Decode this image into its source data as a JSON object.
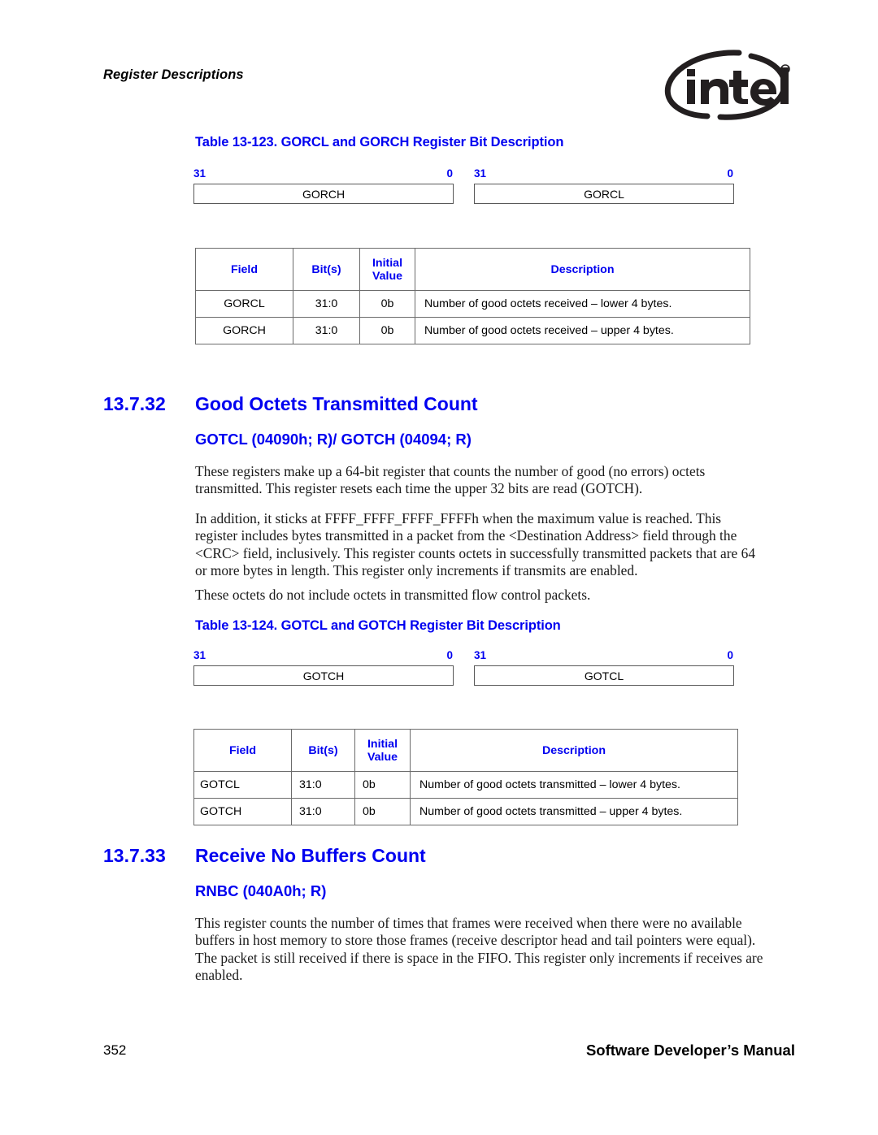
{
  "header": {
    "running_title": "Register Descriptions",
    "logo_wordmark": "intel",
    "logo_registered": "®"
  },
  "colors": {
    "heading_blue": "#0000f0",
    "table_border": "#6b6b6b",
    "register_box_border": "#595959",
    "body_text": "#1a1a1a"
  },
  "table_123": {
    "caption": "Table 13-123. GORCL and GORCH Register Bit Description",
    "diagram": {
      "left": {
        "bit_high": "31",
        "bit_low": "0",
        "label": "GORCH"
      },
      "right": {
        "bit_high": "31",
        "bit_low": "0",
        "label": "GORCL"
      }
    },
    "columns": [
      "Field",
      "Bit(s)",
      "Initial Value",
      "Description"
    ],
    "column_initial_line1": "Initial",
    "column_initial_line2": "Value",
    "rows": [
      {
        "field": "GORCL",
        "bits": "31:0",
        "initial": "0b",
        "description": "Number of good octets received – lower 4 bytes."
      },
      {
        "field": "GORCH",
        "bits": "31:0",
        "initial": "0b",
        "description": "Number of good octets received – upper 4 bytes."
      }
    ]
  },
  "section_13_7_32": {
    "number": "13.7.32",
    "title": "Good Octets Transmitted Count",
    "subtitle": "GOTCL (04090h; R)/ GOTCH (04094; R)",
    "paragraphs": [
      "These registers make up a 64-bit register that counts the number of good (no errors) octets transmitted. This register resets each time the upper 32 bits are read (GOTCH).",
      "In addition, it sticks at FFFF_FFFF_FFFF_FFFFh when the maximum value is reached. This register includes bytes transmitted in a packet from the <Destination Address> field through the <CRC> field, inclusively. This register counts octets in successfully transmitted packets that are 64 or more bytes in length. This register only increments if transmits are enabled.",
      "These octets do not include octets in transmitted flow control packets."
    ]
  },
  "table_124": {
    "caption": "Table 13-124. GOTCL and GOTCH Register Bit Description",
    "diagram": {
      "left": {
        "bit_high": "31",
        "bit_low": "0",
        "label": "GOTCH"
      },
      "right": {
        "bit_high": "31",
        "bit_low": "0",
        "label": "GOTCL"
      }
    },
    "columns": [
      "Field",
      "Bit(s)",
      "Initial Value",
      "Description"
    ],
    "column_initial_line1": "Initial",
    "column_initial_line2": "Value",
    "rows": [
      {
        "field": "GOTCL",
        "bits": "31:0",
        "initial": "0b",
        "description": "Number of good octets transmitted – lower 4 bytes."
      },
      {
        "field": "GOTCH",
        "bits": "31:0",
        "initial": "0b",
        "description": "Number of good octets transmitted – upper 4 bytes."
      }
    ]
  },
  "section_13_7_33": {
    "number": "13.7.33",
    "title": "Receive No Buffers Count",
    "subtitle": "RNBC (040A0h; R)",
    "paragraphs": [
      "This register counts the number of times that frames were received when there were no available buffers in host memory to store those frames (receive descriptor head and tail pointers were equal). The packet is still received if there is space in the FIFO. This register only increments if receives are enabled."
    ]
  },
  "footer": {
    "page_number": "352",
    "manual_title": "Software Developer’s Manual"
  }
}
